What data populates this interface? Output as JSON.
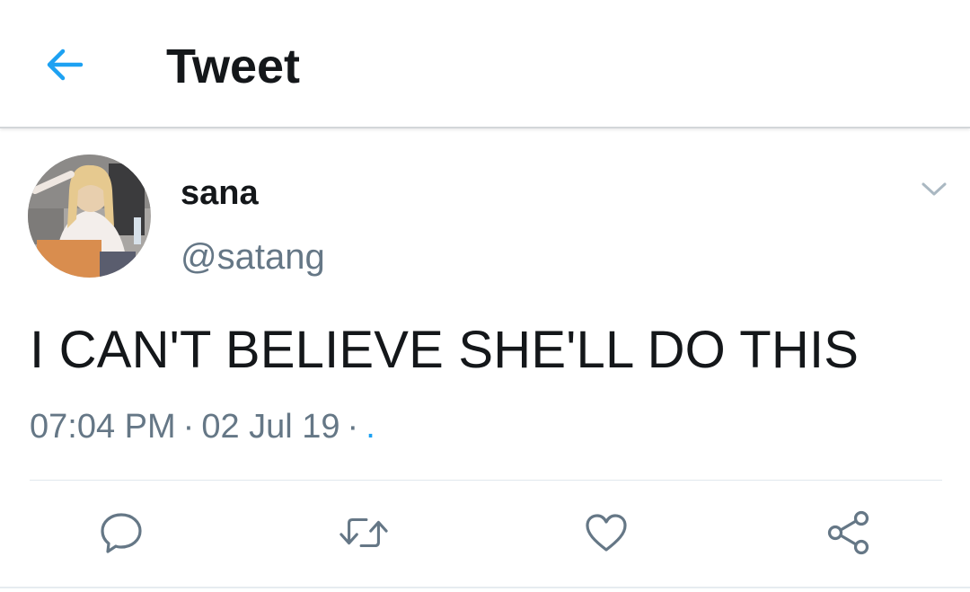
{
  "header": {
    "back_icon": "arrow-left-icon",
    "title": "Tweet"
  },
  "tweet": {
    "author": {
      "display_name": "sana",
      "handle": "@satang",
      "avatar_icon": "profile-photo"
    },
    "caret_icon": "chevron-down-icon",
    "text": "I CAN'T BELIEVE SHE'LL DO THIS",
    "time": "07:04 PM",
    "separator": "·",
    "date": "02 Jul 19",
    "source": "."
  },
  "actions": [
    {
      "icon": "reply-icon"
    },
    {
      "icon": "retweet-icon"
    },
    {
      "icon": "like-icon"
    },
    {
      "icon": "share-icon"
    }
  ],
  "colors": {
    "accent": "#1da1f2",
    "secondary_text": "#657786",
    "primary_text": "#14171a"
  }
}
